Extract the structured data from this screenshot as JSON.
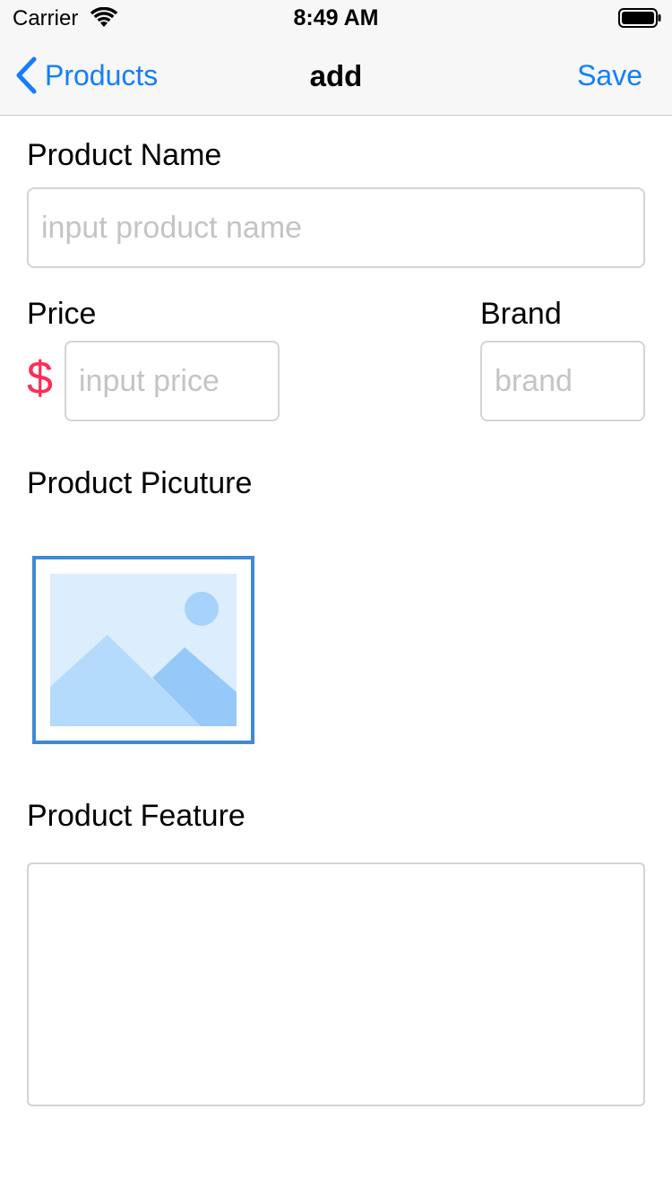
{
  "status_bar": {
    "carrier": "Carrier",
    "time": "8:49 AM",
    "wifi_icon": "wifi-icon",
    "battery_icon": "battery-icon"
  },
  "nav": {
    "back_label": "Products",
    "back_icon": "chevron-left-icon",
    "title": "add",
    "save_label": "Save",
    "accent_color": "#147efb"
  },
  "form": {
    "product_name": {
      "label": "Product Name",
      "value": "",
      "placeholder": "input product name"
    },
    "price": {
      "label": "Price",
      "currency_symbol": "$",
      "currency_color": "#ff2d55",
      "value": "",
      "placeholder": "input price"
    },
    "brand": {
      "label": "Brand",
      "value": "",
      "placeholder": "brand"
    },
    "picture": {
      "label": "Product Picuture",
      "icon": "image-placeholder-icon"
    },
    "feature": {
      "label": "Product Feature",
      "value": ""
    }
  }
}
